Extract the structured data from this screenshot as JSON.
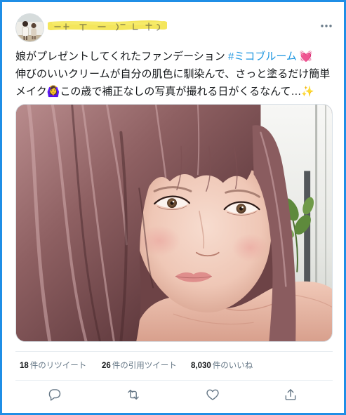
{
  "colors": {
    "frame_border": "#1f8ee6",
    "text": "#14171a",
    "hashtag": "#1b95e0",
    "muted": "#657786",
    "divider": "#e6ecf0",
    "highlighter": "#f3e34a"
  },
  "header": {
    "avatar_icon": "avatar-photo-icon",
    "more_icon": "more-horizontal-icon"
  },
  "tweet": {
    "line1": {
      "text": "娘がプレゼントしてくれたファンデーション ",
      "hashtag": "#ミコブルーム",
      "emoji": "💓"
    },
    "line2": {
      "text": "伸びのいいクリームが自分の肌色に馴染んで、さっと塗るだけ簡単"
    },
    "line3": {
      "text_a": "メイク",
      "emoji_a": "🙆‍♀️",
      "text_b": "この歳で補正なしの写真が撮れる日がくるなんて…",
      "emoji_b": "✨"
    },
    "photo_icon": "selfie-photo-icon"
  },
  "stats": [
    {
      "value": "18",
      "label": "件のリツイート"
    },
    {
      "value": "26",
      "label": "件の引用ツイート"
    },
    {
      "value": "8,030",
      "label": "件のいいね"
    }
  ],
  "actions": {
    "reply_icon": "reply-icon",
    "retweet_icon": "retweet-icon",
    "like_icon": "like-icon",
    "share_icon": "share-icon"
  }
}
